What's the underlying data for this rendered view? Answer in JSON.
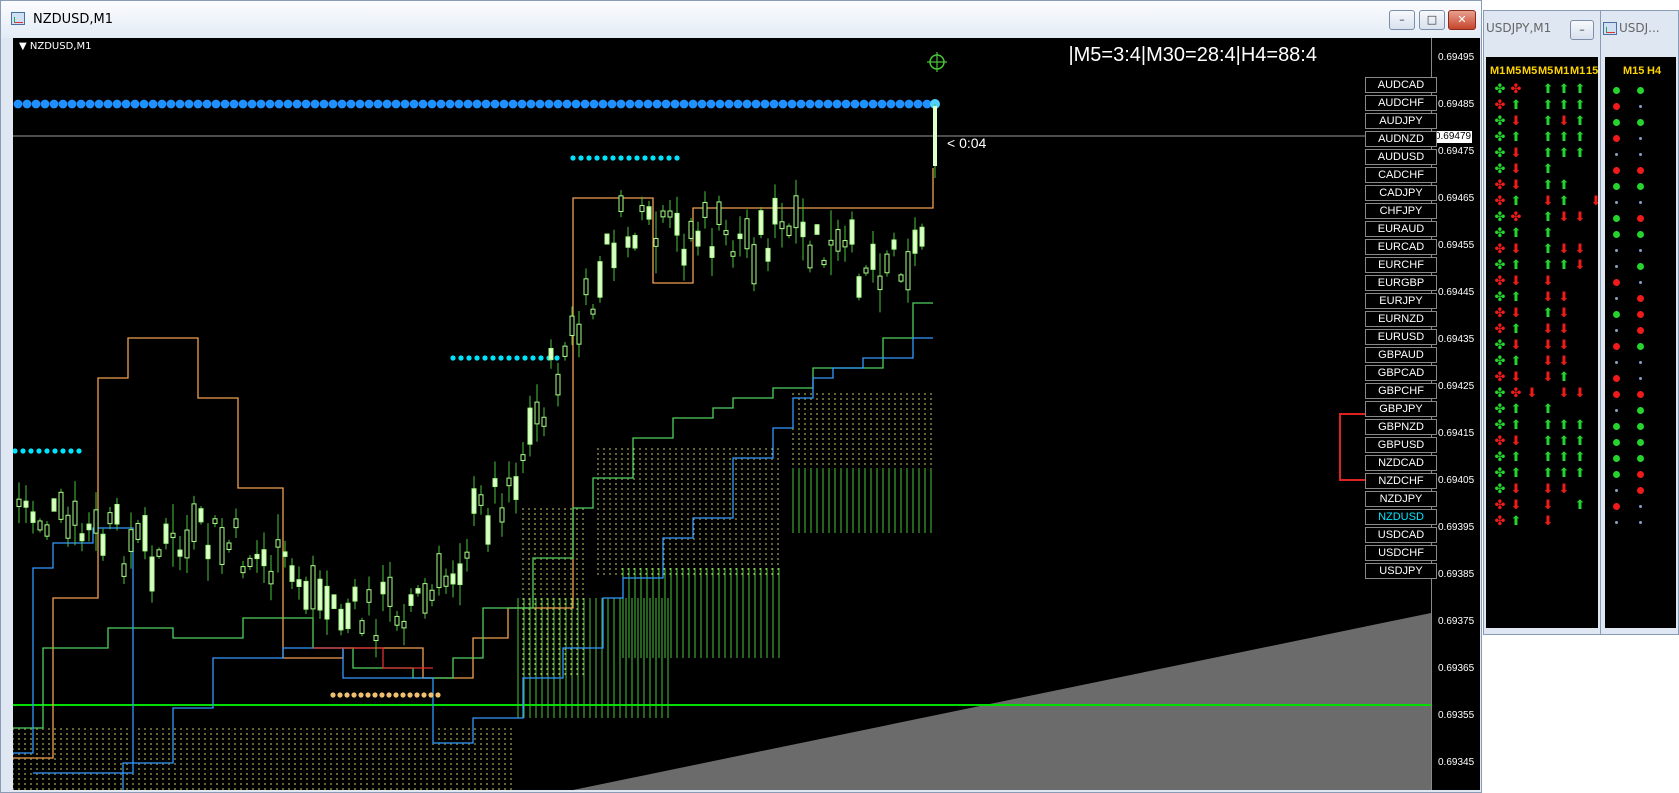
{
  "window": {
    "title": "NZDUSD,M1",
    "chart_label": "NZDUSD,M1",
    "min": "–",
    "max": "□",
    "close": "✕"
  },
  "ticker_text": "|M5=3:4|M30=28:4|H4=88:4",
  "timer_text": "< 0:04",
  "price_axis": {
    "ticks": [
      "0.69495",
      "0.69485",
      "0.69475",
      "0.69465",
      "0.69455",
      "0.69445",
      "0.69435",
      "0.69425",
      "0.69415",
      "0.69405",
      "0.69395",
      "0.69385",
      "0.69375",
      "0.69365",
      "0.69355",
      "0.69345"
    ],
    "current": "0.69479"
  },
  "symbols": [
    {
      "label": "AUDCAD"
    },
    {
      "label": "AUDCHF"
    },
    {
      "label": "AUDJPY"
    },
    {
      "label": "AUDNZD"
    },
    {
      "label": "AUDUSD"
    },
    {
      "label": "CADCHF"
    },
    {
      "label": "CADJPY"
    },
    {
      "label": "CHFJPY"
    },
    {
      "label": "EURAUD"
    },
    {
      "label": "EURCAD"
    },
    {
      "label": "EURCHF"
    },
    {
      "label": "EURGBP"
    },
    {
      "label": "EURJPY"
    },
    {
      "label": "EURNZD"
    },
    {
      "label": "EURUSD"
    },
    {
      "label": "GBPAUD"
    },
    {
      "label": "GBPCAD"
    },
    {
      "label": "GBPCHF"
    },
    {
      "label": "GBPJPY"
    },
    {
      "label": "GBPNZD"
    },
    {
      "label": "GBPUSD"
    },
    {
      "label": "NZDCAD"
    },
    {
      "label": "NZDCHF"
    },
    {
      "label": "NZDJPY"
    },
    {
      "label": "NZDUSD",
      "active": true
    },
    {
      "label": "USDCAD"
    },
    {
      "label": "USDCHF"
    },
    {
      "label": "USDJPY"
    }
  ],
  "side1": {
    "title": "USDJPY,M1",
    "headers": [
      "M1",
      "M5",
      "M5",
      "M5",
      "M1",
      "M1",
      "15"
    ],
    "rows": [
      "gr uuu",
      "ru uuu",
      "gd udu",
      "gu uuu",
      "gd uuu",
      "gd u",
      "rd uu",
      "ru du d",
      "gr udd d",
      "gu u",
      "rd udd",
      "gu uud",
      "rd d",
      "gu dd",
      "rd ud",
      "ru dd",
      "gd dd",
      "gu dd",
      "rd du",
      "grd dd",
      "gu u",
      "gu uuu",
      "rd uuu",
      "gu uuu",
      "gu uuu",
      "gd dd",
      "rd d u",
      "ru d"
    ]
  },
  "side2": {
    "title": "USDJ...",
    "headers": [
      "M15",
      "H4"
    ],
    "rows": [
      "gg",
      "rs",
      "gg",
      "rs",
      "ss",
      "rr",
      "gg",
      "ss",
      "gr",
      "gg",
      "ss",
      "sg",
      "rs",
      "sr",
      "gr",
      "sr",
      "rg",
      "ss",
      "rs",
      "rr",
      "sg",
      "gg",
      "gg",
      "gg",
      "gr",
      "sr",
      "rs",
      "ss"
    ]
  },
  "colors": {
    "bg": "#000000",
    "candle": "#aaff88",
    "up_arrow": "#25d52e",
    "down_arrow": "#f01a1a",
    "blue_dots": "#1e90ff",
    "cyan_dots": "#00e5ff",
    "green_line": "#00dd00"
  }
}
